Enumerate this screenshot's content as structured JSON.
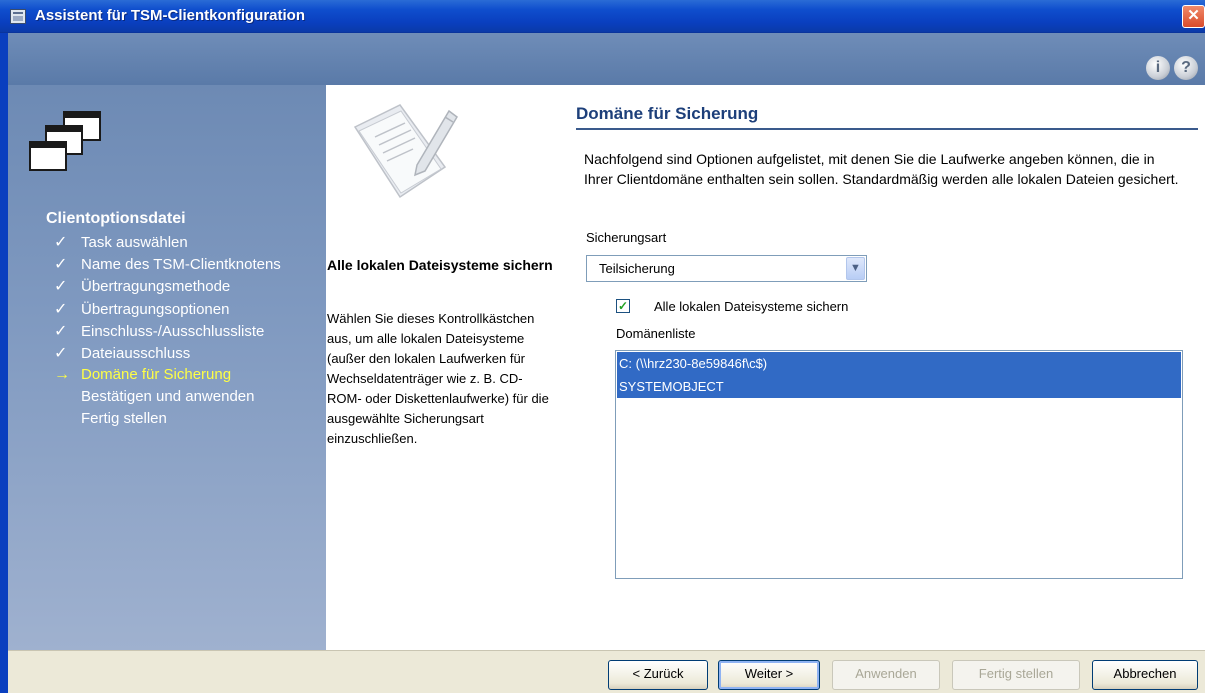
{
  "window": {
    "title": "Assistent für TSM-Clientkonfiguration",
    "close_glyph": "✕"
  },
  "header": {
    "info_icon": "i",
    "help_icon": "?"
  },
  "nav": {
    "heading": "Clientoptionsdatei",
    "steps": [
      {
        "label": "Task auswählen",
        "state": "done"
      },
      {
        "label": "Name des TSM-Clientknotens",
        "state": "done"
      },
      {
        "label": "Übertragungsmethode",
        "state": "done"
      },
      {
        "label": "Übertragungsoptionen",
        "state": "done"
      },
      {
        "label": "Einschluss-/Ausschlussliste",
        "state": "done"
      },
      {
        "label": "Dateiausschluss",
        "state": "done"
      },
      {
        "label": "Domäne für Sicherung",
        "state": "current"
      },
      {
        "label": "Bestätigen und anwenden",
        "state": "pending"
      },
      {
        "label": "Fertig stellen",
        "state": "pending"
      }
    ],
    "done_mark": "✓",
    "current_mark": "→"
  },
  "help_panel": {
    "title": "Alle lokalen Dateisysteme sichern",
    "body": "Wählen Sie dieses Kontrollkästchen aus, um alle lokalen Dateisysteme (außer den lokalen Laufwerken für Wechseldatenträger wie z. B. CD-ROM- oder Diskettenlaufwerke) für die ausgewählte Sicherungsart einzuschließen."
  },
  "content": {
    "title": "Domäne für Sicherung",
    "intro": "Nachfolgend sind Optionen aufgelistet, mit denen Sie die Laufwerke angeben können, die in Ihrer Clientdomäne enthalten sein sollen. Standardmäßig werden alle lokalen Dateien gesichert.",
    "backup_type_label": "Sicherungsart",
    "backup_type_value": "Teilsicherung",
    "all_local_checkbox_label": "Alle lokalen Dateisysteme sichern",
    "all_local_checked": true,
    "domain_list_label": "Domänenliste",
    "domain_list": [
      "C: (\\\\hrz230-8e59846f\\c$)",
      "SYSTEMOBJECT"
    ]
  },
  "footer": {
    "back": "< Zurück",
    "next": "Weiter >",
    "apply": "Anwenden",
    "finish": "Fertig stellen",
    "cancel": "Abbrechen"
  }
}
